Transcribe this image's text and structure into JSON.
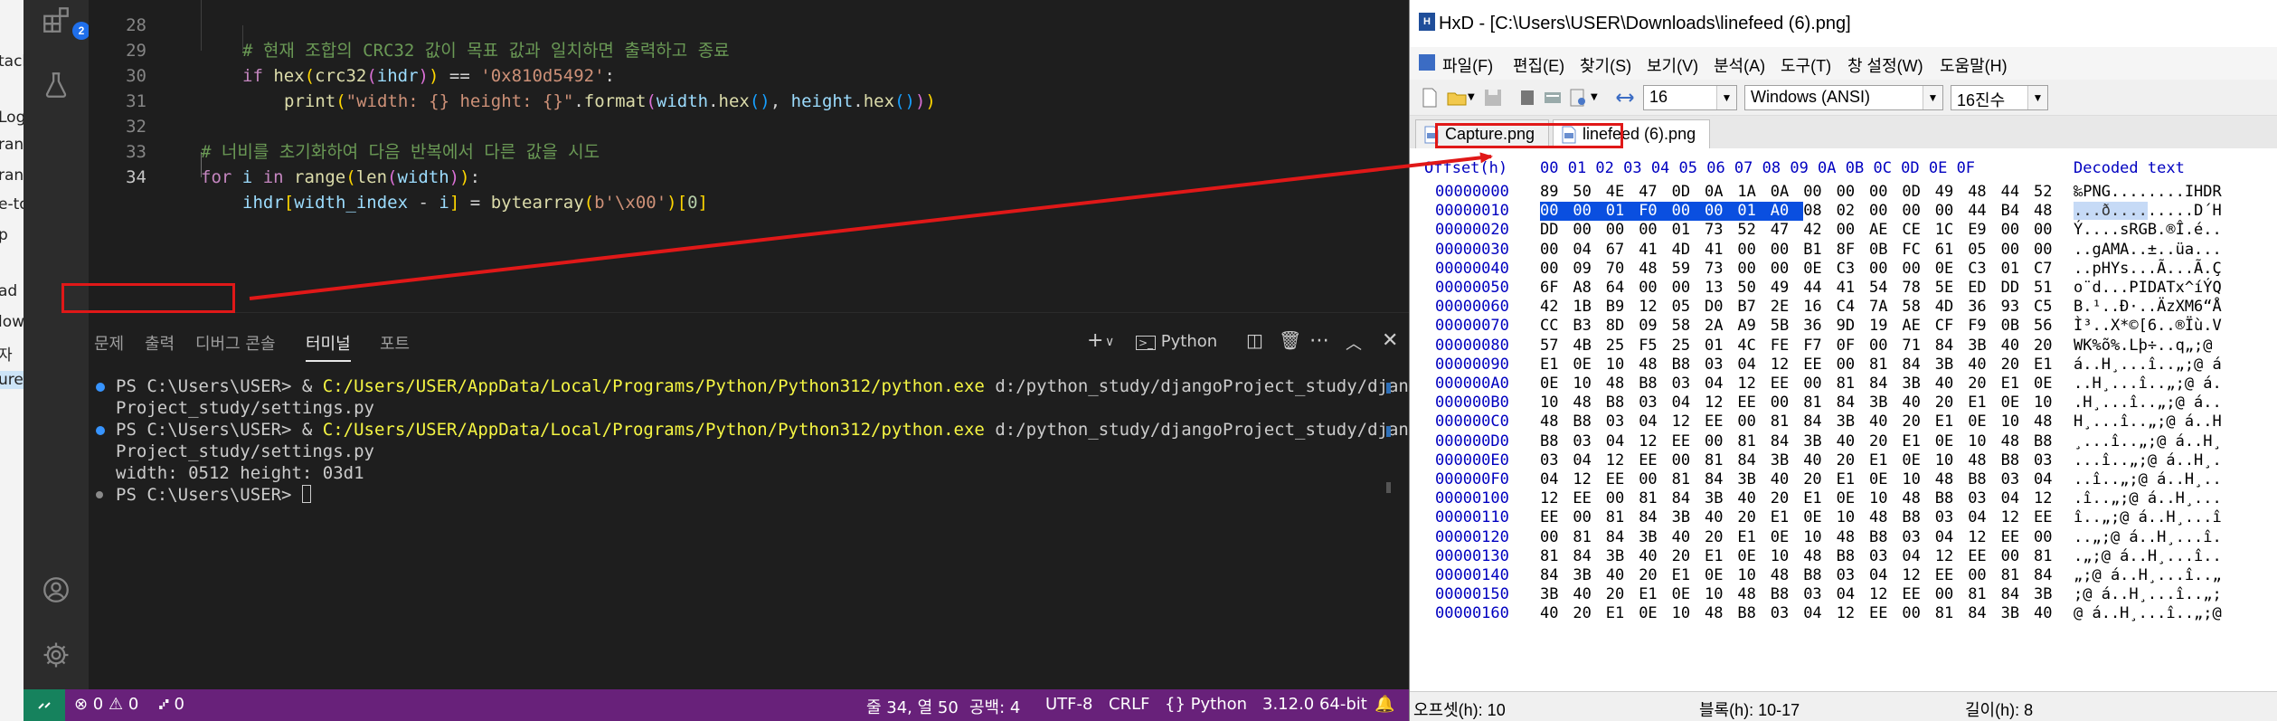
{
  "desktop": {
    "fragments": [
      "tack",
      "Log",
      "ran",
      "ran",
      "e-to",
      "p",
      "ad",
      "low",
      "자",
      "ure"
    ]
  },
  "vscode": {
    "badge": "2",
    "editor": {
      "lines": [
        {
          "n": "28",
          "text": "# 현재 조합의 CRC32 값이 목표 값과 일치하면 출력하고 종료"
        },
        {
          "n": "29",
          "text": "if hex(crc32(ihdr)) == '0x810d5492':"
        },
        {
          "n": "30",
          "text": "print(\"width: {} height: {}\".format(width.hex(), height.hex()))"
        },
        {
          "n": "31",
          "text": ""
        },
        {
          "n": "32",
          "text": "# 너비를 초기화하여 다음 반복에서 다른 값을 시도"
        },
        {
          "n": "33",
          "text": "for i in range(len(width)):"
        },
        {
          "n": "34",
          "text": "ihdr[width_index - i] = bytearray(b'\\x00')[0]"
        }
      ]
    },
    "panel": {
      "tabs": [
        "문제",
        "출력",
        "디버그 콘솔",
        "터미널",
        "포트"
      ],
      "active_tab": "터미널",
      "shell": "Python",
      "terminal": {
        "prompt": "PS C:\\Users\\USER> & ",
        "python_path": "C:/Users/USER/AppData/Local/Programs/Python/Python312/python.exe",
        "script_arg": " d:/python_study/djangoProject_study/django",
        "wrap": "Project_study/settings.py",
        "output": "width: 0512 height: 03d1",
        "last_prompt": "PS C:\\Users\\USER> "
      }
    },
    "statusbar": {
      "problems": "⊗ 0 ⚠ 0",
      "ports": "⑇ 0",
      "position": "줄 34, 열 50",
      "spaces": "공백: 4",
      "encoding": "UTF-8",
      "eol": "CRLF",
      "language": "Python",
      "interpreter": "3.12.0 64-bit"
    }
  },
  "hxd": {
    "title": "HxD - [C:\\Users\\USER\\Downloads\\linefeed (6).png]",
    "menu": [
      "파일(F)",
      "편집(E)",
      "찾기(S)",
      "보기(V)",
      "분석(A)",
      "도구(T)",
      "창 설정(W)",
      "도움말(H)"
    ],
    "toolbar": {
      "bytes_per_row": "16",
      "charset": "Windows (ANSI)",
      "base": "16진수"
    },
    "tabs": [
      "Capture.png",
      "linefeed (6).png"
    ],
    "active_tab": "linefeed (6).png",
    "header": {
      "offset": "Offset(h)",
      "columns": [
        "00",
        "01",
        "02",
        "03",
        "04",
        "05",
        "06",
        "07",
        "08",
        "09",
        "0A",
        "0B",
        "0C",
        "0D",
        "0E",
        "0F"
      ],
      "decoded": "Decoded text"
    },
    "rows": [
      {
        "off": "00000000",
        "bytes": [
          "89",
          "50",
          "4E",
          "47",
          "0D",
          "0A",
          "1A",
          "0A",
          "00",
          "00",
          "00",
          "0D",
          "49",
          "48",
          "44",
          "52"
        ],
        "text": "‰PNG........IHDR"
      },
      {
        "off": "00000010",
        "bytes": [
          "00",
          "00",
          "01",
          "F0",
          "00",
          "00",
          "01",
          "A0",
          "08",
          "02",
          "00",
          "00",
          "00",
          "44",
          "B4",
          "48"
        ],
        "text": "...ð....",
        "text2": ".....D´H"
      },
      {
        "off": "00000020",
        "bytes": [
          "DD",
          "00",
          "00",
          "00",
          "01",
          "73",
          "52",
          "47",
          "42",
          "00",
          "AE",
          "CE",
          "1C",
          "E9",
          "00",
          "00"
        ],
        "text": "Ý....sRGB.®Î.é.."
      },
      {
        "off": "00000030",
        "bytes": [
          "00",
          "04",
          "67",
          "41",
          "4D",
          "41",
          "00",
          "00",
          "B1",
          "8F",
          "0B",
          "FC",
          "61",
          "05",
          "00",
          "00"
        ],
        "text": "..gAMA..±..üa..."
      },
      {
        "off": "00000040",
        "bytes": [
          "00",
          "09",
          "70",
          "48",
          "59",
          "73",
          "00",
          "00",
          "0E",
          "C3",
          "00",
          "00",
          "0E",
          "C3",
          "01",
          "C7"
        ],
        "text": "..pHYs...Ã...Ã.Ç"
      },
      {
        "off": "00000050",
        "bytes": [
          "6F",
          "A8",
          "64",
          "00",
          "00",
          "13",
          "50",
          "49",
          "44",
          "41",
          "54",
          "78",
          "5E",
          "ED",
          "DD",
          "51"
        ],
        "text": "o¨d...PIDATx^íÝQ"
      },
      {
        "off": "00000060",
        "bytes": [
          "42",
          "1B",
          "B9",
          "12",
          "05",
          "D0",
          "B7",
          "2E",
          "16",
          "C4",
          "7A",
          "58",
          "4D",
          "36",
          "93",
          "C5"
        ],
        "text": "B.¹..Ð·..ÄzXM6“Å"
      },
      {
        "off": "00000070",
        "bytes": [
          "CC",
          "B3",
          "8D",
          "09",
          "58",
          "2A",
          "A9",
          "5B",
          "36",
          "9D",
          "19",
          "AE",
          "CF",
          "F9",
          "0B",
          "56"
        ],
        "text": "Ì³..X*©[6..®Ïù.V"
      },
      {
        "off": "00000080",
        "bytes": [
          "57",
          "4B",
          "25",
          "F5",
          "25",
          "01",
          "4C",
          "FE",
          "F7",
          "0F",
          "00",
          "71",
          "84",
          "3B",
          "40",
          "20"
        ],
        "text": "WK%õ%.Lþ÷..q„;@ "
      },
      {
        "off": "00000090",
        "bytes": [
          "E1",
          "0E",
          "10",
          "48",
          "B8",
          "03",
          "04",
          "12",
          "EE",
          "00",
          "81",
          "84",
          "3B",
          "40",
          "20",
          "E1"
        ],
        "text": "á..H¸...î..„;@ á"
      },
      {
        "off": "000000A0",
        "bytes": [
          "0E",
          "10",
          "48",
          "B8",
          "03",
          "04",
          "12",
          "EE",
          "00",
          "81",
          "84",
          "3B",
          "40",
          "20",
          "E1",
          "0E"
        ],
        "text": "..H¸...î..„;@ á."
      },
      {
        "off": "000000B0",
        "bytes": [
          "10",
          "48",
          "B8",
          "03",
          "04",
          "12",
          "EE",
          "00",
          "81",
          "84",
          "3B",
          "40",
          "20",
          "E1",
          "0E",
          "10"
        ],
        "text": ".H¸...î..„;@ á.."
      },
      {
        "off": "000000C0",
        "bytes": [
          "48",
          "B8",
          "03",
          "04",
          "12",
          "EE",
          "00",
          "81",
          "84",
          "3B",
          "40",
          "20",
          "E1",
          "0E",
          "10",
          "48"
        ],
        "text": "H¸...î..„;@ á..H"
      },
      {
        "off": "000000D0",
        "bytes": [
          "B8",
          "03",
          "04",
          "12",
          "EE",
          "00",
          "81",
          "84",
          "3B",
          "40",
          "20",
          "E1",
          "0E",
          "10",
          "48",
          "B8"
        ],
        "text": "¸...î..„;@ á..H¸"
      },
      {
        "off": "000000E0",
        "bytes": [
          "03",
          "04",
          "12",
          "EE",
          "00",
          "81",
          "84",
          "3B",
          "40",
          "20",
          "E1",
          "0E",
          "10",
          "48",
          "B8",
          "03"
        ],
        "text": "...î..„;@ á..H¸."
      },
      {
        "off": "000000F0",
        "bytes": [
          "04",
          "12",
          "EE",
          "00",
          "81",
          "84",
          "3B",
          "40",
          "20",
          "E1",
          "0E",
          "10",
          "48",
          "B8",
          "03",
          "04"
        ],
        "text": "..î..„;@ á..H¸.."
      },
      {
        "off": "00000100",
        "bytes": [
          "12",
          "EE",
          "00",
          "81",
          "84",
          "3B",
          "40",
          "20",
          "E1",
          "0E",
          "10",
          "48",
          "B8",
          "03",
          "04",
          "12"
        ],
        "text": ".î..„;@ á..H¸..."
      },
      {
        "off": "00000110",
        "bytes": [
          "EE",
          "00",
          "81",
          "84",
          "3B",
          "40",
          "20",
          "E1",
          "0E",
          "10",
          "48",
          "B8",
          "03",
          "04",
          "12",
          "EE"
        ],
        "text": "î..„;@ á..H¸...î"
      },
      {
        "off": "00000120",
        "bytes": [
          "00",
          "81",
          "84",
          "3B",
          "40",
          "20",
          "E1",
          "0E",
          "10",
          "48",
          "B8",
          "03",
          "04",
          "12",
          "EE",
          "00"
        ],
        "text": "..„;@ á..H¸...î."
      },
      {
        "off": "00000130",
        "bytes": [
          "81",
          "84",
          "3B",
          "40",
          "20",
          "E1",
          "0E",
          "10",
          "48",
          "B8",
          "03",
          "04",
          "12",
          "EE",
          "00",
          "81"
        ],
        "text": ".„;@ á..H¸...î.."
      },
      {
        "off": "00000140",
        "bytes": [
          "84",
          "3B",
          "40",
          "20",
          "E1",
          "0E",
          "10",
          "48",
          "B8",
          "03",
          "04",
          "12",
          "EE",
          "00",
          "81",
          "84"
        ],
        "text": "„;@ á..H¸...î..„"
      },
      {
        "off": "00000150",
        "bytes": [
          "3B",
          "40",
          "20",
          "E1",
          "0E",
          "10",
          "48",
          "B8",
          "03",
          "04",
          "12",
          "EE",
          "00",
          "81",
          "84",
          "3B"
        ],
        "text": ";@ á..H¸...î..„;"
      },
      {
        "off": "00000160",
        "bytes": [
          "40",
          "20",
          "E1",
          "0E",
          "10",
          "48",
          "B8",
          "03",
          "04",
          "12",
          "EE",
          "00",
          "81",
          "84",
          "3B",
          "40"
        ],
        "text": "@ á..H¸...î..„;@"
      }
    ],
    "status": {
      "offset": "오프셋(h): 10",
      "block": "블록(h): 10-17",
      "length": "길이(h): 8"
    }
  },
  "colors": {
    "annotation": "#e01818",
    "selection": "#0a4fe0",
    "statusbar": "#68217a",
    "remote": "#16825d"
  }
}
